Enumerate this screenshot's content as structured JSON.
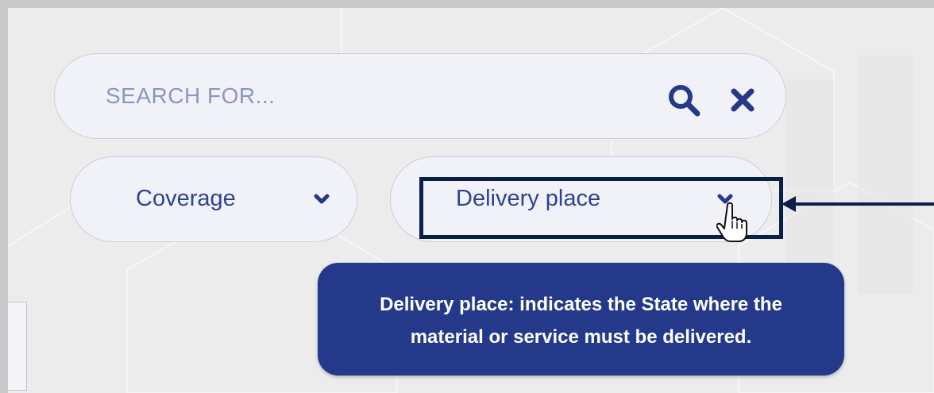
{
  "search": {
    "placeholder": "SEARCH FOR...",
    "value": ""
  },
  "filters": {
    "coverage": {
      "label": "Coverage"
    },
    "delivery_place": {
      "label": "Delivery place"
    }
  },
  "tooltip": {
    "line1": "Delivery place: indicates the State where the",
    "line2": "material or service must be delivered."
  },
  "icons": {
    "search": "search-icon",
    "close": "close-icon",
    "chevron": "chevron-down-icon",
    "cursor": "hand-pointer-icon",
    "arrow": "arrow-left-icon"
  },
  "colors": {
    "accent": "#24398a",
    "text": "#2f4290",
    "placeholder": "#8c95c2",
    "highlight": "#0a1f4a",
    "pill_bg": "#f1f2f8",
    "page_bg": "#ececec"
  }
}
